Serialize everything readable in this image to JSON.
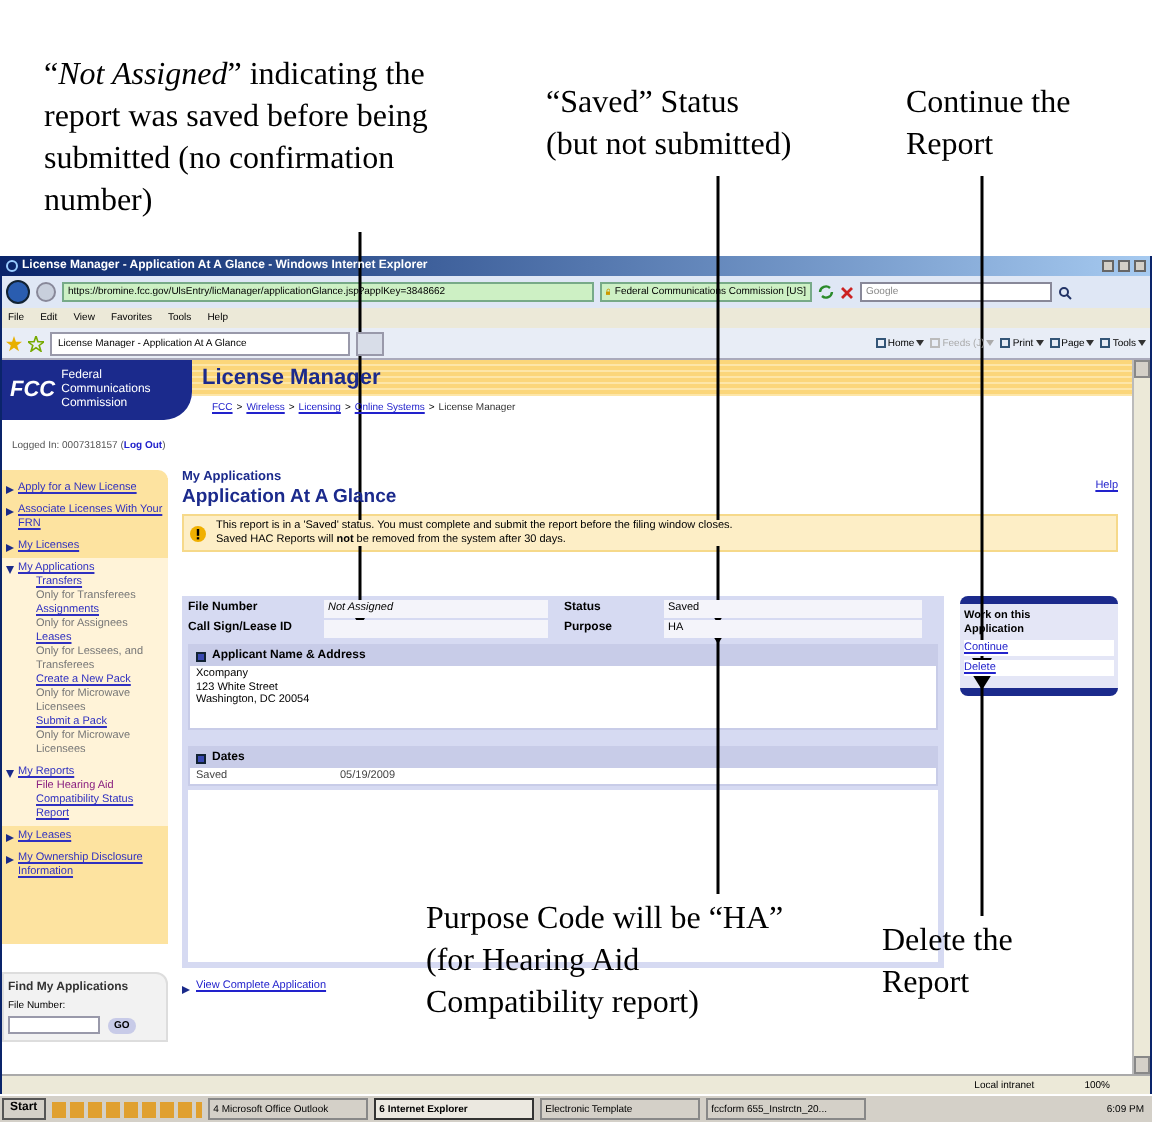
{
  "callouts": [
    {
      "text": "“*Not Assigned*” indicating the report was saved before being submitted (no confirmation number)"
    },
    {
      "text": "“Saved” Status (but not submitted)"
    },
    {
      "text": "Continue the Report"
    },
    {
      "text": "Purpose Code will be “HA” (for Hearing Aid Compatibility report)"
    },
    {
      "text": "Delete the Report"
    }
  ],
  "window": {
    "title": "License Manager - Application At A Glance - Windows Internet Explorer",
    "address": "https://bromine.fcc.gov/UlsEntry/licManager/applicationGlance.jsp?applKey=3848662",
    "site_identity": "Federal Communications Commission [US]",
    "search_placeholder": "Google",
    "menu": [
      "File",
      "Edit",
      "View",
      "Favorites",
      "Tools",
      "Help"
    ],
    "tab": "License Manager - Application At A Glance",
    "toolbar": [
      {
        "label": "Home",
        "disabled": false
      },
      {
        "label": "Feeds (J)",
        "disabled": true
      },
      {
        "label": "Print",
        "disabled": false
      },
      {
        "label": "Page",
        "disabled": false
      },
      {
        "label": "Tools",
        "disabled": false
      }
    ]
  },
  "header": {
    "logo": "FCC",
    "separator": ">",
    "agency": "Federal Communications Commission",
    "app_title": "License Manager",
    "breadcrumb": [
      {
        "label": "FCC",
        "link": true
      },
      {
        "label": "Wireless",
        "link": true
      },
      {
        "label": "Licensing",
        "link": true
      },
      {
        "label": "Online Systems",
        "link": true
      },
      {
        "label": "License Manager",
        "link": false
      }
    ]
  },
  "login": {
    "prefix": "Logged In: 0007318157 (",
    "link": "Log Out",
    "suffix": ")"
  },
  "sidebar": {
    "items": [
      {
        "label": "Apply for a New License",
        "expanded": false
      },
      {
        "label": "Associate Licenses With Your FRN",
        "expanded": false
      },
      {
        "label": "My Licenses",
        "expanded": false
      },
      {
        "label": "My Applications",
        "expanded": true,
        "children": [
          {
            "label": "Transfers",
            "note": "Only for Transferees"
          },
          {
            "label": "Assignments",
            "note": "Only for Assignees"
          },
          {
            "label": "Leases",
            "note": "Only for Lessees, and Transferees"
          },
          {
            "label": "Create a New Pack",
            "note": "Only for Microwave Licensees"
          },
          {
            "label": "Submit a Pack",
            "note": "Only for Microwave Licensees"
          }
        ]
      },
      {
        "label": "My Reports",
        "expanded": true,
        "children": [
          {
            "prefix": "File Hearing Aid",
            "label": "Compatibility Status Report"
          }
        ]
      },
      {
        "label": "My Leases",
        "expanded": false
      },
      {
        "label": "My Ownership Disclosure Information",
        "expanded": false
      }
    ]
  },
  "find": {
    "title": "Find My Applications",
    "field_label": "File Number:",
    "button": "GO"
  },
  "main": {
    "section": "My Applications",
    "title": "Application At A Glance",
    "help": "Help",
    "alert_lines": [
      "This report is in a 'Saved' status. You must complete and submit the report before the filing window closes.",
      "Saved HAC Reports will **not** be removed from the system after 30 days."
    ],
    "fields": [
      {
        "label": "File Number",
        "value": "Not Assigned",
        "italic": true
      },
      {
        "label": "Status",
        "value": "Saved",
        "italic": false
      },
      {
        "label": "Call Sign/Lease ID"
      },
      {
        "label": "Purpose",
        "value": "HA",
        "italic": false
      }
    ],
    "applicant": {
      "title": "Applicant Name & Address",
      "lines": [
        "Xcompany",
        "123 White Street",
        "Washington, DC 20054"
      ]
    },
    "dates": {
      "title": "Dates",
      "rows": [
        {
          "label": "Saved",
          "value": "05/19/2009"
        }
      ]
    },
    "view_link": "View Complete Application"
  },
  "actions": {
    "title": "Work on this Application",
    "links": [
      "Continue",
      "Delete"
    ]
  },
  "status_bar": {
    "zone": "Local intranet",
    "zoom": "100%"
  },
  "taskbar": {
    "start": "Start",
    "buttons": [
      {
        "label": "4 Microsoft Office Outlook",
        "selected": false
      },
      {
        "label": "6 Internet Explorer",
        "selected": true
      },
      {
        "label": "Electronic Template",
        "selected": false
      },
      {
        "label": "fccform 655_Instrctn_20...",
        "selected": false
      }
    ],
    "clock": "6:09 PM"
  }
}
